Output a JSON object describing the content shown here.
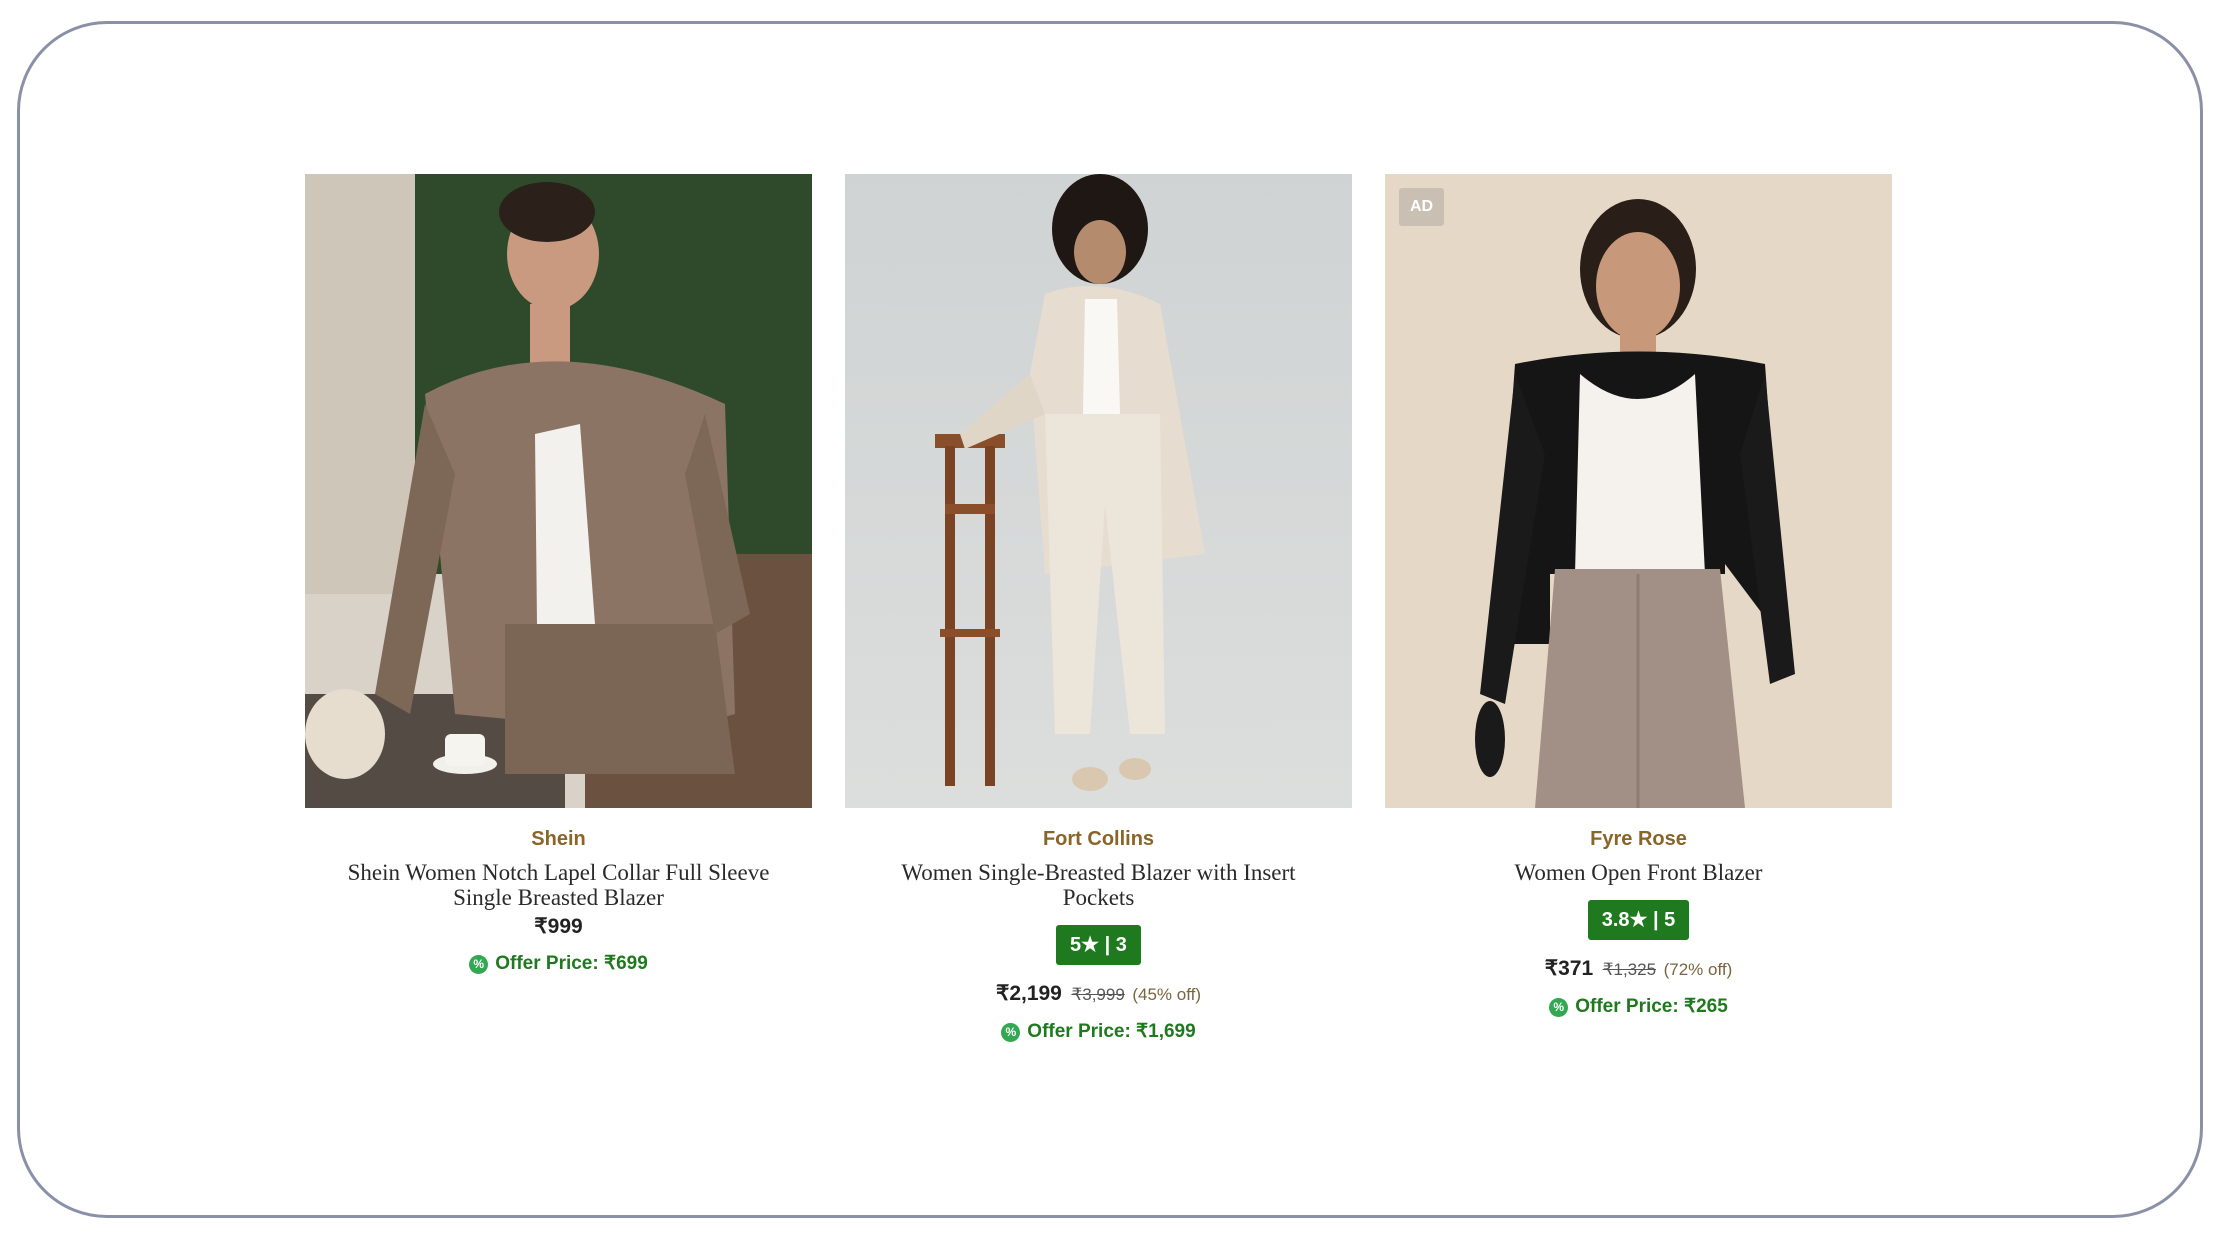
{
  "products": [
    {
      "brand": "Shein",
      "title": "Shein Women Notch Lapel Collar Full Sleeve Single Breasted Blazer",
      "price": "₹999",
      "offer_price": "Offer Price: ₹699"
    },
    {
      "brand": "Fort Collins",
      "title": "Women Single-Breasted Blazer with Insert Pockets",
      "rating": "5★ | 3",
      "price": "₹2,199",
      "mrp": "₹3,999",
      "discount": "(45% off)",
      "offer_price": "Offer Price: ₹1,699"
    },
    {
      "brand": "Fyre Rose",
      "title": "Women Open Front Blazer",
      "ad_label": "AD",
      "rating": "3.8★ | 5",
      "price": "₹371",
      "mrp": "₹1,325",
      "discount": "(72% off)",
      "offer_price": "Offer Price: ₹265"
    }
  ],
  "colors": {
    "brand_text": "#8a6428",
    "rating_bg": "#1f7a1f",
    "offer_text": "#1f7a1f",
    "frame_border": "#8a90a8"
  }
}
